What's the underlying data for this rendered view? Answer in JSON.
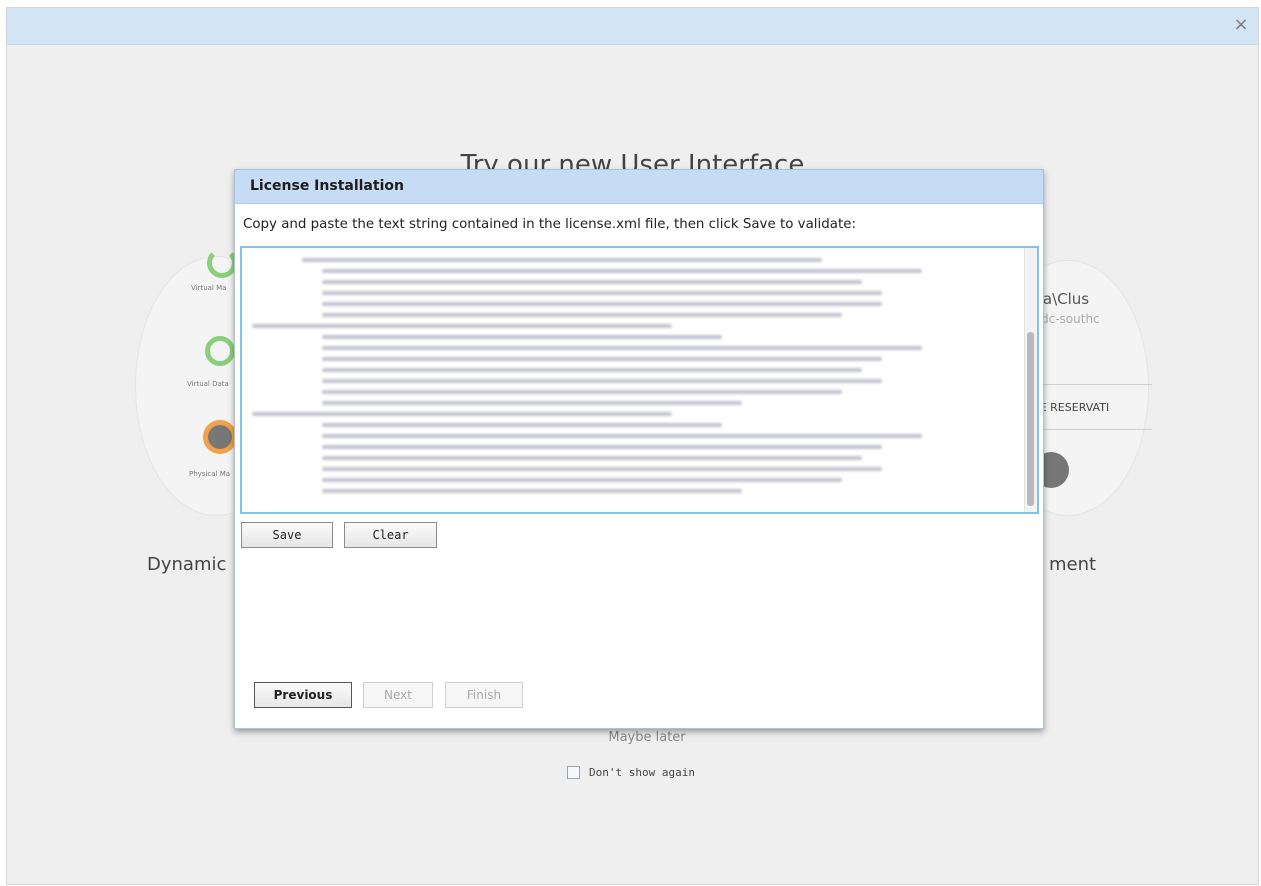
{
  "background": {
    "title": "Try our new User Interface",
    "caption_left": "Dynamic",
    "caption_right": "ment",
    "cluster_label": "ta\\Clus",
    "cluster_sub": "dc-southc",
    "reserve_button": "TE RESERVATI",
    "left_diagram_labels": [
      "Virtual Ma",
      "Virtual Data",
      "Physical Ma"
    ],
    "maybe_later": "Maybe later",
    "dont_show_again": "Don't show again",
    "close_symbol": "×"
  },
  "dialog": {
    "title": "License Installation",
    "instructions": "Copy and paste the text string contained in the license.xml file, then click Save to validate:",
    "save_label": "Save",
    "clear_label": "Clear",
    "previous_label": "Previous",
    "next_label": "Next",
    "finish_label": "Finish"
  },
  "colors": {
    "dialog_header": "#c6dcf4",
    "textarea_border": "#86c1e6",
    "outer_bar": "#d3e4f5"
  }
}
